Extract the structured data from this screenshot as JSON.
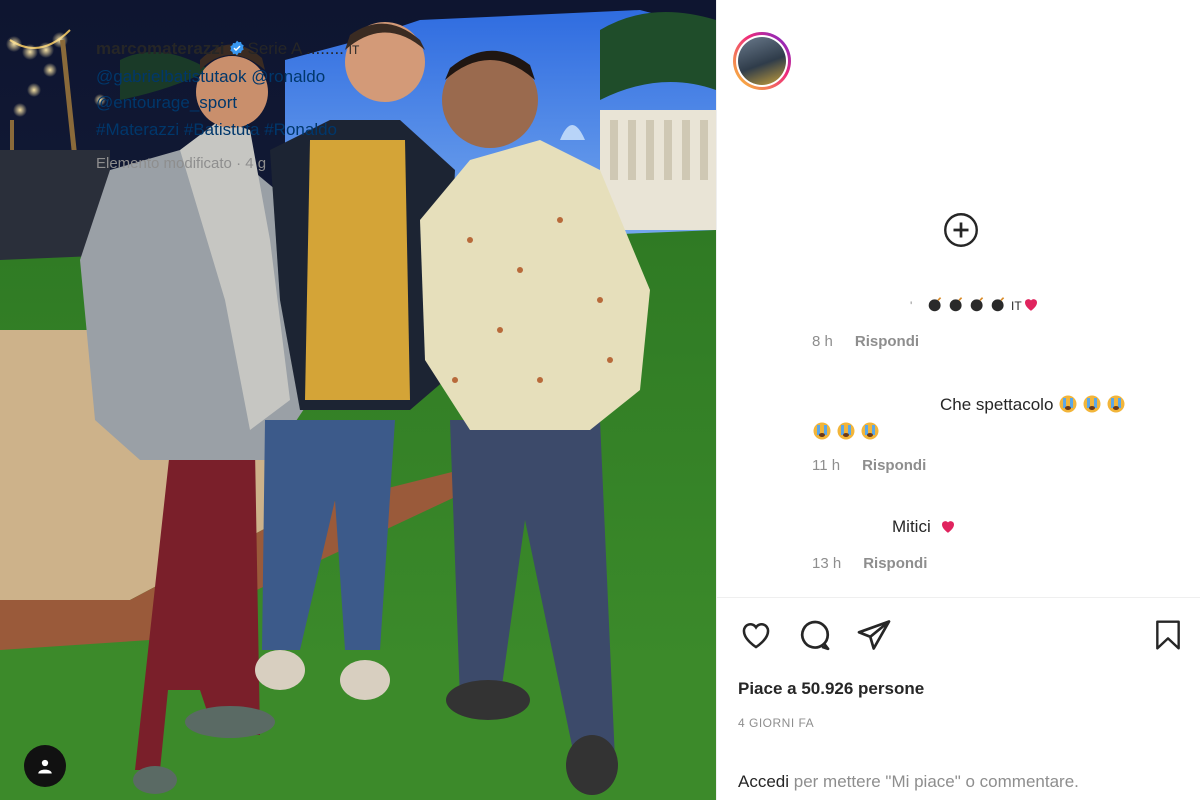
{
  "post": {
    "username": "marcomaterazzi",
    "caption_text": "Serie A ........ ",
    "caption_flag": "IT",
    "mentions": [
      "@gabrielbatistutaok",
      "@ronaldo",
      "@entourage_sport"
    ],
    "hashtags": [
      "#Materazzi",
      "#Batistuta",
      "#Ronaldo"
    ],
    "edited_label": "Elemento modificato",
    "time_short": "4 g",
    "likes_label": "Piace a 50.926 persone",
    "time_ago": "4 GIORNI FA",
    "login_link": "Accedi",
    "login_rest": " per mettere \"Mi piace\" o commentare."
  },
  "comments": [
    {
      "text": "",
      "prefix": "'",
      "flag": "IT",
      "time": "8 h",
      "reply": "Rispondi"
    },
    {
      "text": "Che spettacolo",
      "time": "11 h",
      "reply": "Rispondi"
    },
    {
      "text": "Mitici",
      "time": "13 h",
      "reply": "Rispondi"
    }
  ],
  "icons": [
    "verified-badge-icon",
    "add-circle-icon",
    "like-heart-icon",
    "comment-icon",
    "share-icon",
    "save-bookmark-icon",
    "user-tag-icon"
  ],
  "colors": {
    "link": "#00376b",
    "muted": "#8e8e8e",
    "text": "#262626",
    "verified": "#3897f0",
    "heart": "#ed4956"
  }
}
